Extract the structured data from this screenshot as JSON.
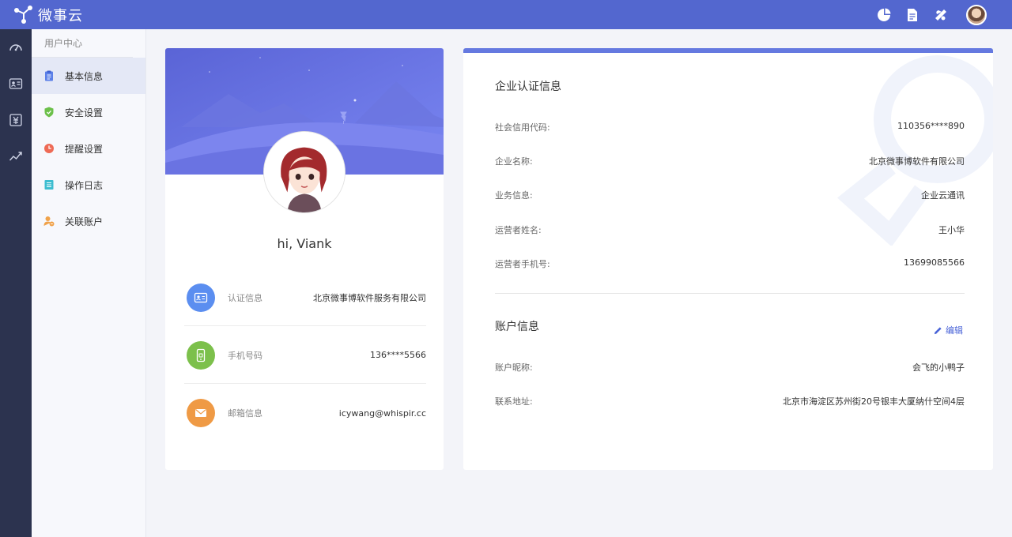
{
  "app": {
    "name": "微事云"
  },
  "colors": {
    "brand": "#5367cf",
    "rail": "#2c334f",
    "accent": "#4a64d8"
  },
  "topbar": {
    "icons": [
      "pie-chart-icon",
      "document-icon",
      "notification-icon"
    ]
  },
  "rail": {
    "icons": [
      "dashboard-icon",
      "id-card-icon",
      "billing-icon",
      "trend-chart-icon"
    ]
  },
  "sidebar": {
    "heading": "用户中心",
    "items": [
      {
        "label": "基本信息",
        "icon": "clipboard-icon",
        "active": true
      },
      {
        "label": "安全设置",
        "icon": "shield-icon"
      },
      {
        "label": "提醒设置",
        "icon": "clock-icon"
      },
      {
        "label": "操作日志",
        "icon": "list-icon"
      },
      {
        "label": "关联账户",
        "icon": "linked-user-icon"
      }
    ]
  },
  "profile": {
    "greeting": "hi, Viank",
    "rows": [
      {
        "label": "认证信息",
        "value": "北京微事博软件服务有限公司",
        "icon": "id-card-icon",
        "color": "#5b8ef0"
      },
      {
        "label": "手机号码",
        "value": "136****5566",
        "icon": "phone-icon",
        "color": "#7cc04b"
      },
      {
        "label": "邮箱信息",
        "value": "icywang@whispir.cc",
        "icon": "mail-icon",
        "color": "#ef9a45"
      }
    ]
  },
  "company": {
    "title": "企业认证信息",
    "rows": [
      {
        "k": "社会信用代码:",
        "v": "110356****890"
      },
      {
        "k": "企业名称:",
        "v": "北京微事博软件有限公司"
      },
      {
        "k": "业务信息:",
        "v": "企业云通讯"
      },
      {
        "k": "运营者姓名:",
        "v": "王小华"
      },
      {
        "k": "运营者手机号:",
        "v": "13699085566"
      }
    ]
  },
  "account": {
    "title": "账户信息",
    "edit_label": "编辑",
    "rows": [
      {
        "k": "账户昵称:",
        "v": "会飞的小鸭子"
      },
      {
        "k": "联系地址:",
        "v": "北京市海淀区苏州街20号银丰大厦纳什空间4层"
      }
    ]
  }
}
